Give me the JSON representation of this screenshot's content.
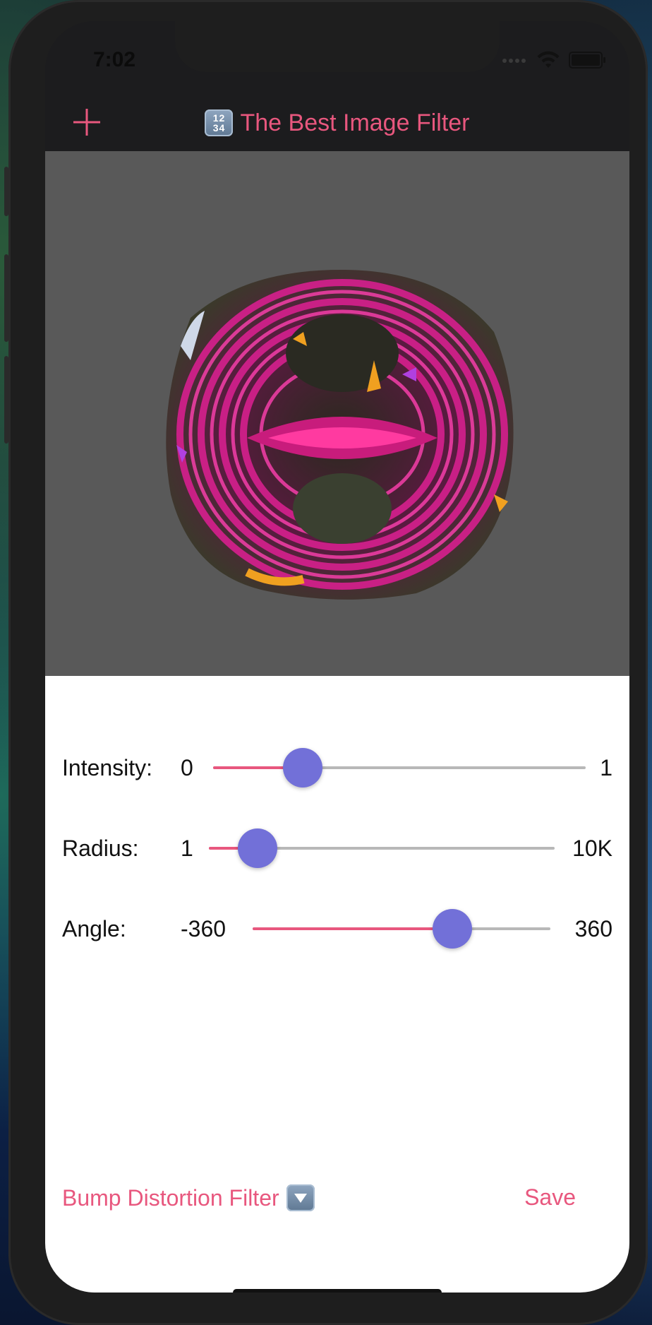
{
  "status_bar": {
    "time": "7:02"
  },
  "navbar": {
    "add_icon": "plus-icon",
    "title_icon": "input-numbers-icon",
    "title_icon_glyph": "1 2\n3 4",
    "title": "The Best Image Filter"
  },
  "image": {
    "description_icon": "bump-distorted-flower-image"
  },
  "sliders": [
    {
      "label": "Intensity:",
      "min": "0",
      "max": "1",
      "value_fraction": 0.24
    },
    {
      "label": "Radius:",
      "min": "1",
      "max": "10K",
      "value_fraction": 0.14
    },
    {
      "label": "Angle:",
      "min": "-360",
      "max": "360",
      "value_fraction": 0.67
    }
  ],
  "bottom_bar": {
    "filter_label": "Bump Distortion Filter",
    "filter_icon": "down-arrow-button-icon",
    "save_label": "Save"
  },
  "colors": {
    "accent": "#e8577e",
    "thumb": "#7270d8",
    "image_background": "#595959"
  }
}
